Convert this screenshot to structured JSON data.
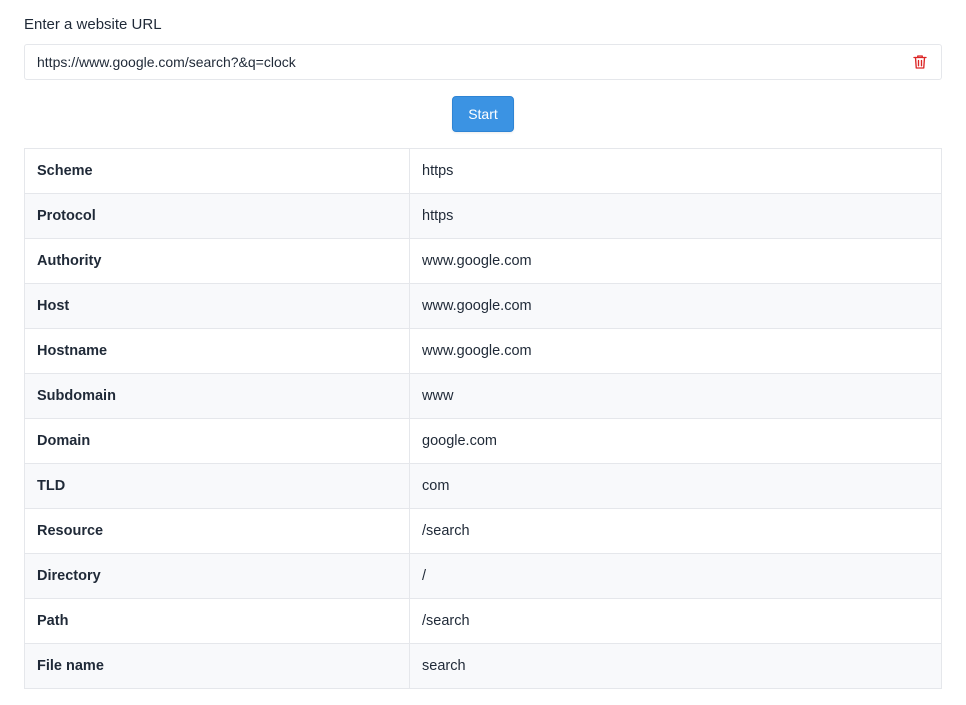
{
  "form": {
    "label": "Enter a website URL",
    "url_value": "https://www.google.com/search?&q=clock",
    "clear_icon": "trash-icon",
    "start_label": "Start"
  },
  "colors": {
    "accent": "#3b93e3",
    "danger": "#dc2626",
    "border": "#e5e7eb",
    "stripe": "#f8f9fb"
  },
  "results": [
    {
      "key": "Scheme",
      "value": "https"
    },
    {
      "key": "Protocol",
      "value": "https"
    },
    {
      "key": "Authority",
      "value": "www.google.com"
    },
    {
      "key": "Host",
      "value": "www.google.com"
    },
    {
      "key": "Hostname",
      "value": "www.google.com"
    },
    {
      "key": "Subdomain",
      "value": "www"
    },
    {
      "key": "Domain",
      "value": "google.com"
    },
    {
      "key": "TLD",
      "value": "com"
    },
    {
      "key": "Resource",
      "value": "/search"
    },
    {
      "key": "Directory",
      "value": "/"
    },
    {
      "key": "Path",
      "value": "/search"
    },
    {
      "key": "File name",
      "value": "search"
    }
  ]
}
